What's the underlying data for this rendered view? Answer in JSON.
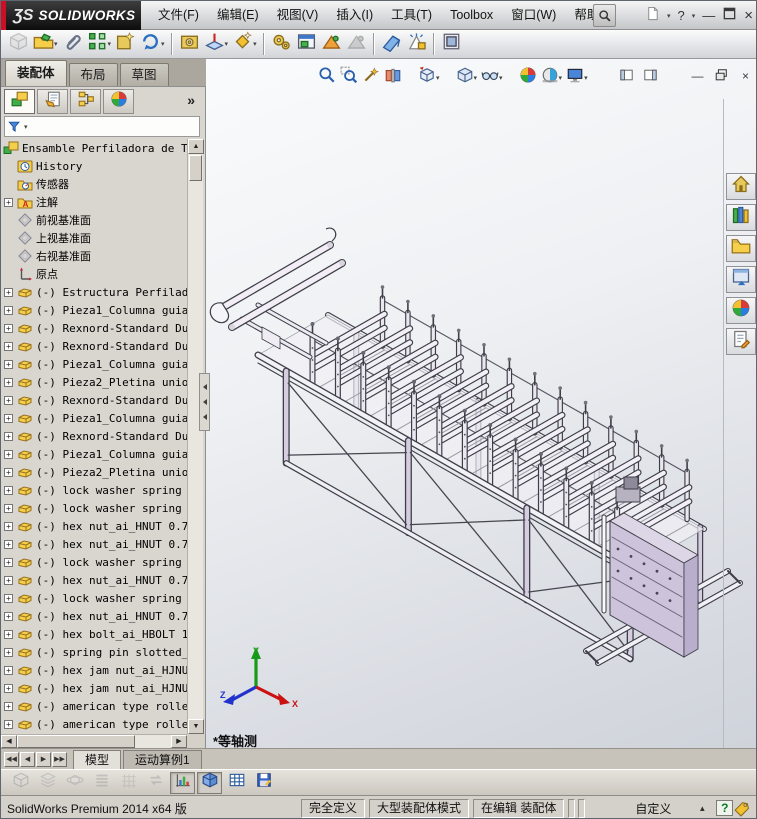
{
  "titlebar": {
    "logo_word": "SOLIDWORKS",
    "menus": [
      "文件(F)",
      "编辑(E)",
      "视图(V)",
      "插入(I)",
      "工具(T)",
      "Toolbox",
      "窗口(W)",
      "帮助(H)"
    ],
    "window_controls": [
      "minimize",
      "restore",
      "close"
    ]
  },
  "assembly_toolbar": [
    {
      "name": "insert-component",
      "icon": "cube-gray",
      "disabled": true
    },
    {
      "name": "open-document",
      "icon": "folder-open",
      "dd": true
    },
    {
      "name": "mate",
      "icon": "paperclip"
    },
    {
      "name": "component-pattern",
      "icon": "pattern",
      "dd": true
    },
    {
      "name": "smart-fasteners",
      "icon": "fastener"
    },
    {
      "name": "move-component",
      "icon": "rotate",
      "dd": true
    },
    {
      "sep": true
    },
    {
      "name": "assembly-features",
      "icon": "gearbox"
    },
    {
      "name": "reference-geometry",
      "icon": "refgeo",
      "dd": true
    },
    {
      "name": "sketch",
      "icon": "diamond-star",
      "dd": true
    },
    {
      "sep": true
    },
    {
      "name": "bill-of-materials",
      "icon": "gears"
    },
    {
      "name": "exploded-view",
      "icon": "window-green"
    },
    {
      "name": "simulation",
      "icon": "ramp"
    },
    {
      "name": "analysis",
      "icon": "ramp",
      "disabled": true
    },
    {
      "sep": true
    },
    {
      "name": "section-tool",
      "icon": "blue-wedge"
    },
    {
      "name": "simulation-advisor",
      "icon": "antenna"
    },
    {
      "sep": true
    },
    {
      "name": "instant3d",
      "icon": "frame-pic"
    }
  ],
  "command_tabs": [
    {
      "label": "装配体",
      "active": true
    },
    {
      "label": "布局",
      "active": false
    },
    {
      "label": "草图",
      "active": false
    }
  ],
  "panel_tabs": [
    {
      "name": "feature-manager",
      "icon": "feature-manager",
      "active": true
    },
    {
      "name": "property-manager",
      "icon": "property-manager",
      "active": false
    },
    {
      "name": "configuration-manager",
      "icon": "configuration-manager",
      "active": false
    },
    {
      "name": "display-manager",
      "icon": "sphere4",
      "active": false
    }
  ],
  "panel_overflow": "»",
  "feature_tree": {
    "items": [
      {
        "icon": "assembly",
        "label": "Ensamble Perfiladora de Te",
        "root": true
      },
      {
        "icon": "history",
        "label": "History"
      },
      {
        "icon": "sensors",
        "label": "传感器"
      },
      {
        "icon": "annotations",
        "label": "注解",
        "expand": true
      },
      {
        "icon": "plane",
        "label": "前视基准面"
      },
      {
        "icon": "plane",
        "label": "上视基准面"
      },
      {
        "icon": "plane",
        "label": "右视基准面"
      },
      {
        "icon": "origin",
        "label": "原点"
      },
      {
        "icon": "part",
        "label": "(-) Estructura Perfilad",
        "expand": true
      },
      {
        "icon": "part",
        "label": "(-) Pieza1_Columna guia",
        "expand": true
      },
      {
        "icon": "part",
        "label": "(-) Rexnord-Standard Du",
        "expand": true
      },
      {
        "icon": "part",
        "label": "(-) Rexnord-Standard Du",
        "expand": true
      },
      {
        "icon": "part",
        "label": "(-) Pieza1_Columna guia",
        "expand": true
      },
      {
        "icon": "part",
        "label": "(-) Pieza2_Pletina unio",
        "expand": true
      },
      {
        "icon": "part",
        "label": "(-) Rexnord-Standard Du",
        "expand": true
      },
      {
        "icon": "part",
        "label": "(-) Pieza1_Columna guia",
        "expand": true
      },
      {
        "icon": "part",
        "label": "(-) Rexnord-Standard Du",
        "expand": true
      },
      {
        "icon": "part",
        "label": "(-) Pieza1_Columna guia",
        "expand": true
      },
      {
        "icon": "part",
        "label": "(-) Pieza2_Pletina unio",
        "expand": true
      },
      {
        "icon": "part",
        "label": "(-) lock washer spring",
        "expand": true
      },
      {
        "icon": "part",
        "label": "(-) lock washer spring",
        "expand": true
      },
      {
        "icon": "part",
        "label": "(-) hex nut_ai_HNUT 0.7",
        "expand": true
      },
      {
        "icon": "part",
        "label": "(-) hex nut_ai_HNUT 0.7",
        "expand": true
      },
      {
        "icon": "part",
        "label": "(-) lock washer spring",
        "expand": true
      },
      {
        "icon": "part",
        "label": "(-) hex nut_ai_HNUT 0.7",
        "expand": true
      },
      {
        "icon": "part",
        "label": "(-) lock washer spring",
        "expand": true
      },
      {
        "icon": "part",
        "label": "(-) hex nut_ai_HNUT 0.7",
        "expand": true
      },
      {
        "icon": "part",
        "label": "(-) hex bolt_ai_HBOLT 1",
        "expand": true
      },
      {
        "icon": "part",
        "label": "(-) spring pin slotted_",
        "expand": true
      },
      {
        "icon": "part",
        "label": "(-) hex jam nut_ai_HJNU",
        "expand": true
      },
      {
        "icon": "part",
        "label": "(-) hex jam nut_ai_HJNU",
        "expand": true
      },
      {
        "icon": "part",
        "label": "(-) american type rolle",
        "expand": true
      },
      {
        "icon": "part",
        "label": "(-) american type rolle",
        "expand": true
      }
    ]
  },
  "headsup_toolbar": [
    {
      "name": "zoom-to-fit",
      "icon": "magnifier"
    },
    {
      "name": "zoom-to-area",
      "icon": "magnifier-area"
    },
    {
      "name": "previous-view",
      "icon": "wand"
    },
    {
      "name": "section-view",
      "icon": "section-book"
    },
    {
      "gap": true
    },
    {
      "name": "view-orientation",
      "icon": "cube-orient",
      "dd": true
    },
    {
      "gap": true
    },
    {
      "name": "display-style",
      "icon": "cube-plain",
      "dd": true
    },
    {
      "name": "hide-show-items",
      "icon": "glasses",
      "dd": true
    },
    {
      "gap": true
    },
    {
      "name": "edit-appearance",
      "icon": "sphere4"
    },
    {
      "name": "apply-scene",
      "icon": "sphere-checker",
      "dd": true
    },
    {
      "name": "view-settings",
      "icon": "monitor",
      "dd": true
    }
  ],
  "doc_window_controls": [
    {
      "name": "collapse-left-pane",
      "icon": "pane-left"
    },
    {
      "name": "collapse-right-pane",
      "icon": "pane-right"
    },
    {
      "gap": true
    },
    {
      "name": "minimize-document",
      "glyph": "—"
    },
    {
      "name": "restore-document",
      "icon": "restore"
    },
    {
      "name": "close-document",
      "glyph": "×"
    }
  ],
  "task_pane": [
    {
      "name": "solidworks-resources",
      "icon": "home"
    },
    {
      "name": "design-library",
      "icon": "design-library"
    },
    {
      "name": "file-explorer",
      "icon": "folder"
    },
    {
      "name": "view-palette",
      "icon": "view-palette"
    },
    {
      "name": "appearances-scenes",
      "icon": "sphere4"
    },
    {
      "name": "custom-properties",
      "icon": "custom-properties"
    }
  ],
  "viewport": {
    "view_label": "*等轴测",
    "triad_labels": {
      "x": "X",
      "y": "Y",
      "z": "Z"
    }
  },
  "bottom_tabs": {
    "nav": [
      "◀◀",
      "◀",
      "▶",
      "▶▶"
    ],
    "tabs": [
      {
        "label": "模型",
        "active": true
      },
      {
        "label": "运动算例1",
        "active": false
      }
    ]
  },
  "motion_toolbar": [
    {
      "name": "model-reload",
      "icon": "cube-gray",
      "disabled": true
    },
    {
      "name": "layers",
      "icon": "layers-gray",
      "disabled": true
    },
    {
      "name": "orbit",
      "icon": "orbit-gray",
      "disabled": true
    },
    {
      "name": "display-lines",
      "icon": "lines-gray",
      "disabled": true
    },
    {
      "name": "grid",
      "icon": "grid-gray",
      "disabled": true
    },
    {
      "name": "swap",
      "icon": "swap-gray",
      "disabled": true
    },
    {
      "name": "chart-view",
      "icon": "chart-bars",
      "pressed": true
    },
    {
      "name": "shaded-view",
      "icon": "cube-blue",
      "pressed": true
    },
    {
      "name": "table-view",
      "icon": "table"
    },
    {
      "name": "save-view",
      "icon": "save"
    }
  ],
  "statusbar": {
    "product": "SolidWorks Premium 2014 x64 版",
    "segments": [
      "完全定义",
      "大型装配体模式",
      "在编辑 装配体"
    ],
    "custom": "自定义",
    "help": "?"
  }
}
